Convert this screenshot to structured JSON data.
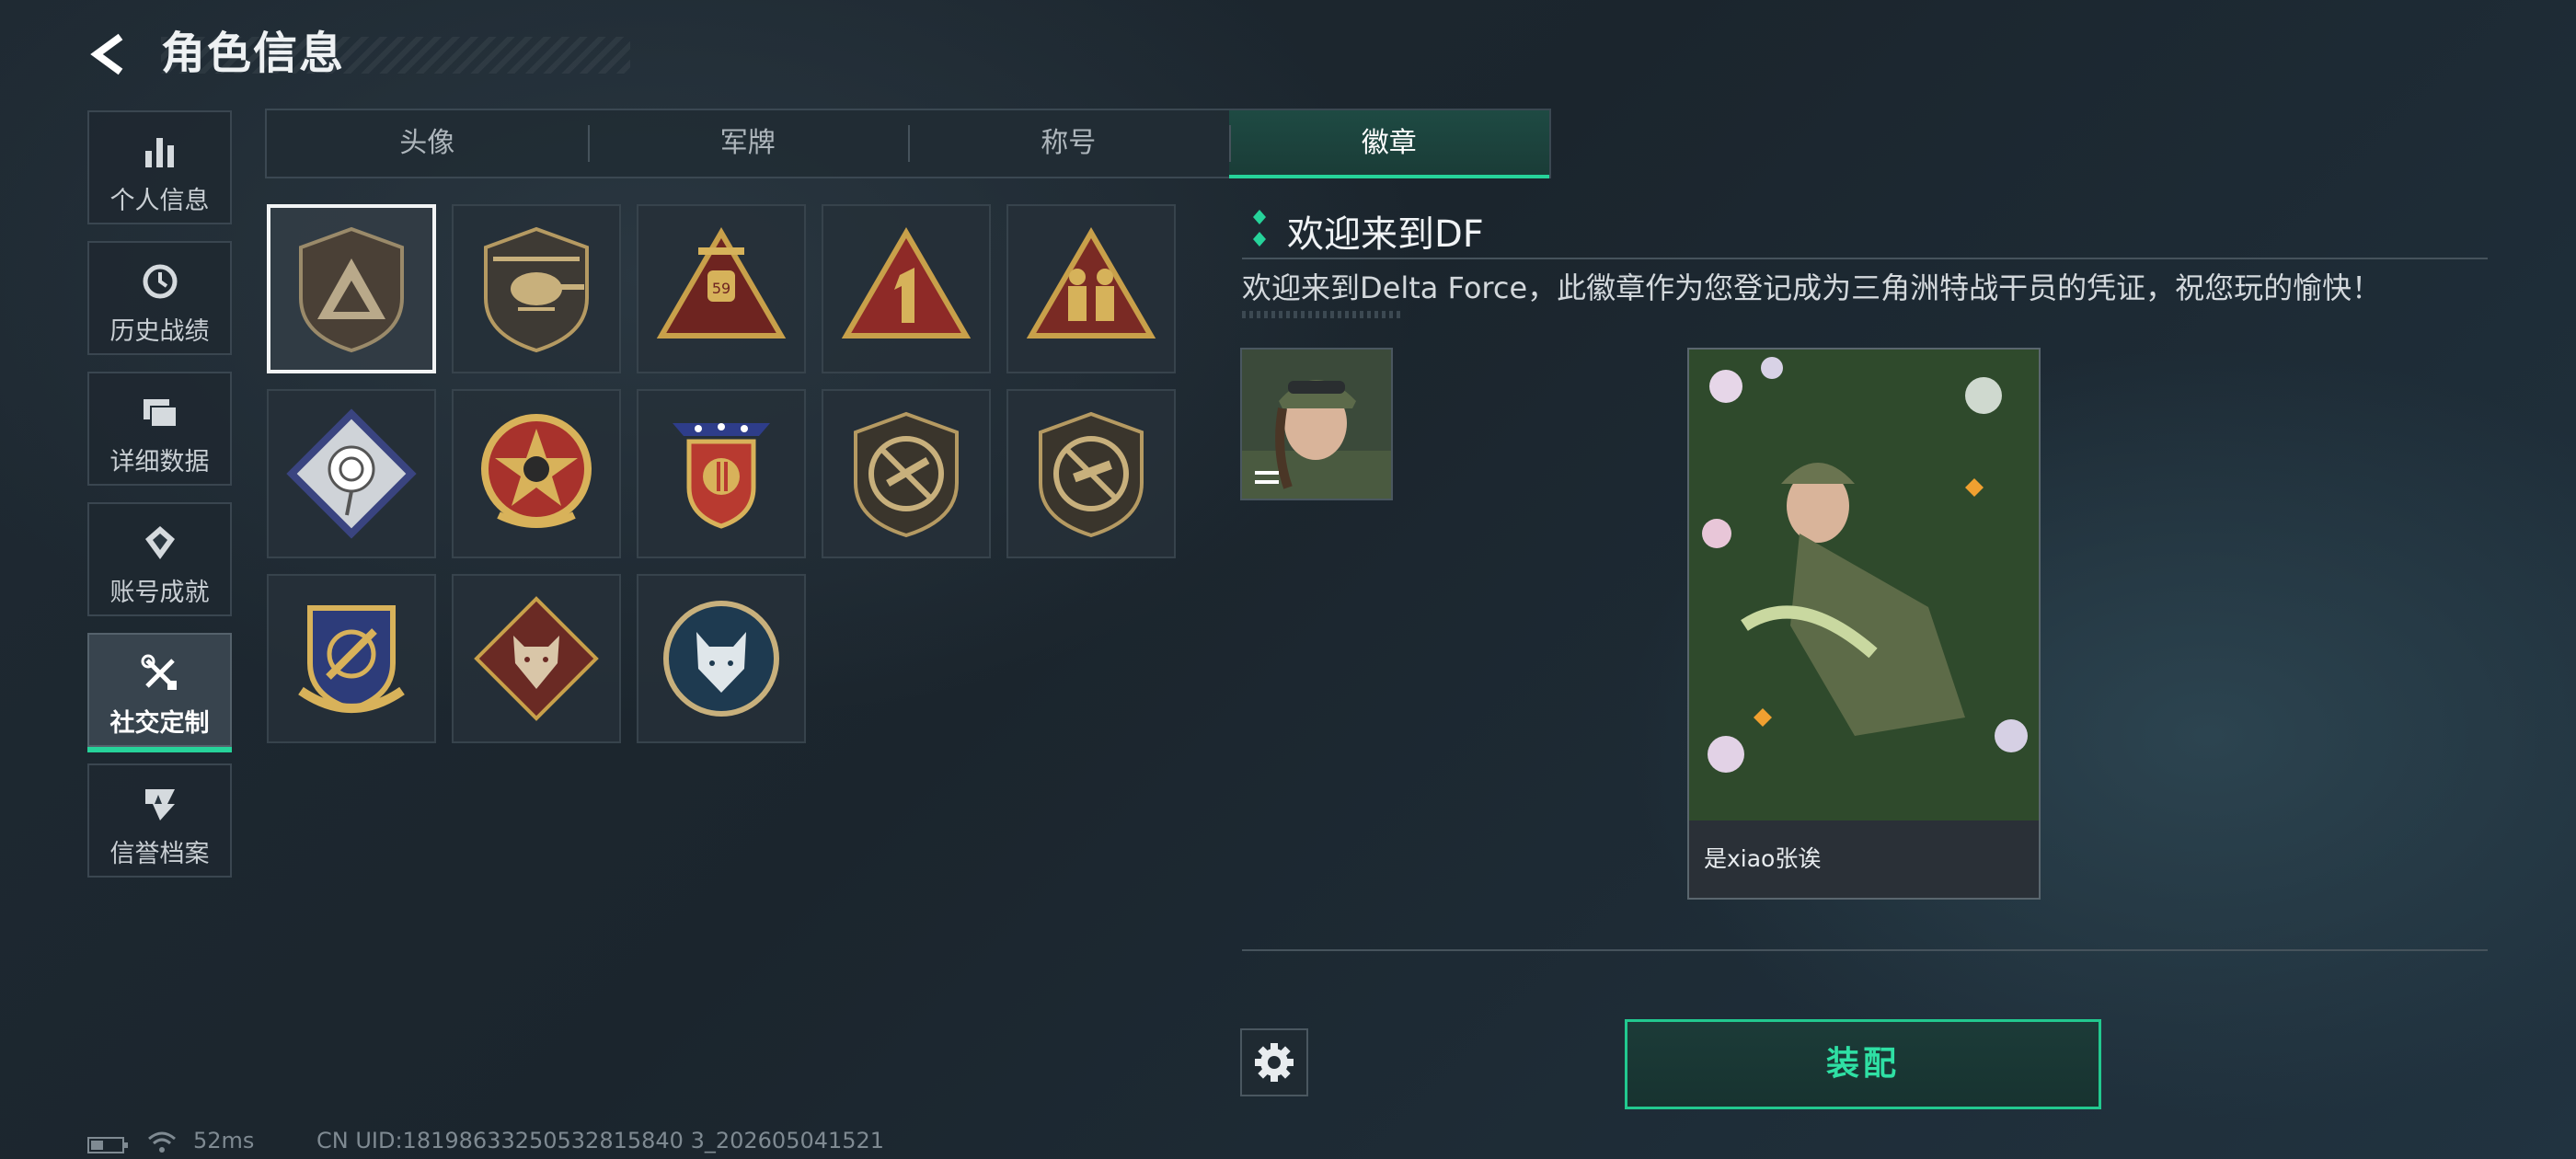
{
  "header": {
    "title": "角色信息"
  },
  "sidebar": {
    "items": [
      {
        "label": "个人信息",
        "icon": "bar-chart-icon",
        "active": false
      },
      {
        "label": "历史战绩",
        "icon": "history-icon",
        "active": false
      },
      {
        "label": "详细数据",
        "icon": "folder-icon",
        "active": false
      },
      {
        "label": "账号成就",
        "icon": "achievement-icon",
        "active": false
      },
      {
        "label": "社交定制",
        "icon": "tools-icon",
        "active": true
      },
      {
        "label": "信誉档案",
        "icon": "reputation-icon",
        "active": false
      }
    ]
  },
  "tabs": [
    {
      "label": "头像",
      "active": false
    },
    {
      "label": "军牌",
      "active": false
    },
    {
      "label": "称号",
      "active": false
    },
    {
      "label": "徽章",
      "active": true
    }
  ],
  "badges": [
    {
      "name": "delta-triangle-badge",
      "selected": true
    },
    {
      "name": "helicopter-badge",
      "selected": false
    },
    {
      "name": "satellite-59-badge",
      "selected": false
    },
    {
      "name": "number-1-badge",
      "selected": false
    },
    {
      "name": "soldiers-badge",
      "selected": false
    },
    {
      "name": "rose-badge",
      "selected": false
    },
    {
      "name": "skull-star-badge",
      "selected": false
    },
    {
      "name": "stars-shield-badge",
      "selected": false
    },
    {
      "name": "no-rifle-badge",
      "selected": false
    },
    {
      "name": "no-smg-badge",
      "selected": false
    },
    {
      "name": "crosshair-shield-badge",
      "selected": false
    },
    {
      "name": "wolf-badge",
      "selected": false
    },
    {
      "name": "lynx-badge",
      "selected": false
    }
  ],
  "detail": {
    "title": "欢迎来到DF",
    "description": "欢迎来到Delta Force，此徽章作为您登记成为三角洲特战干员的凭证，祝您玩的愉快！",
    "card_name": "是xiao张诶"
  },
  "actions": {
    "equip_label": "装配"
  },
  "status": {
    "battery_level": 0.4,
    "ping": "52ms",
    "uid": "CN UID:18198633250532815840 3_202605041521"
  },
  "colors": {
    "accent": "#26d39a",
    "gold": "#c8a04a",
    "red": "#8e2a27"
  }
}
